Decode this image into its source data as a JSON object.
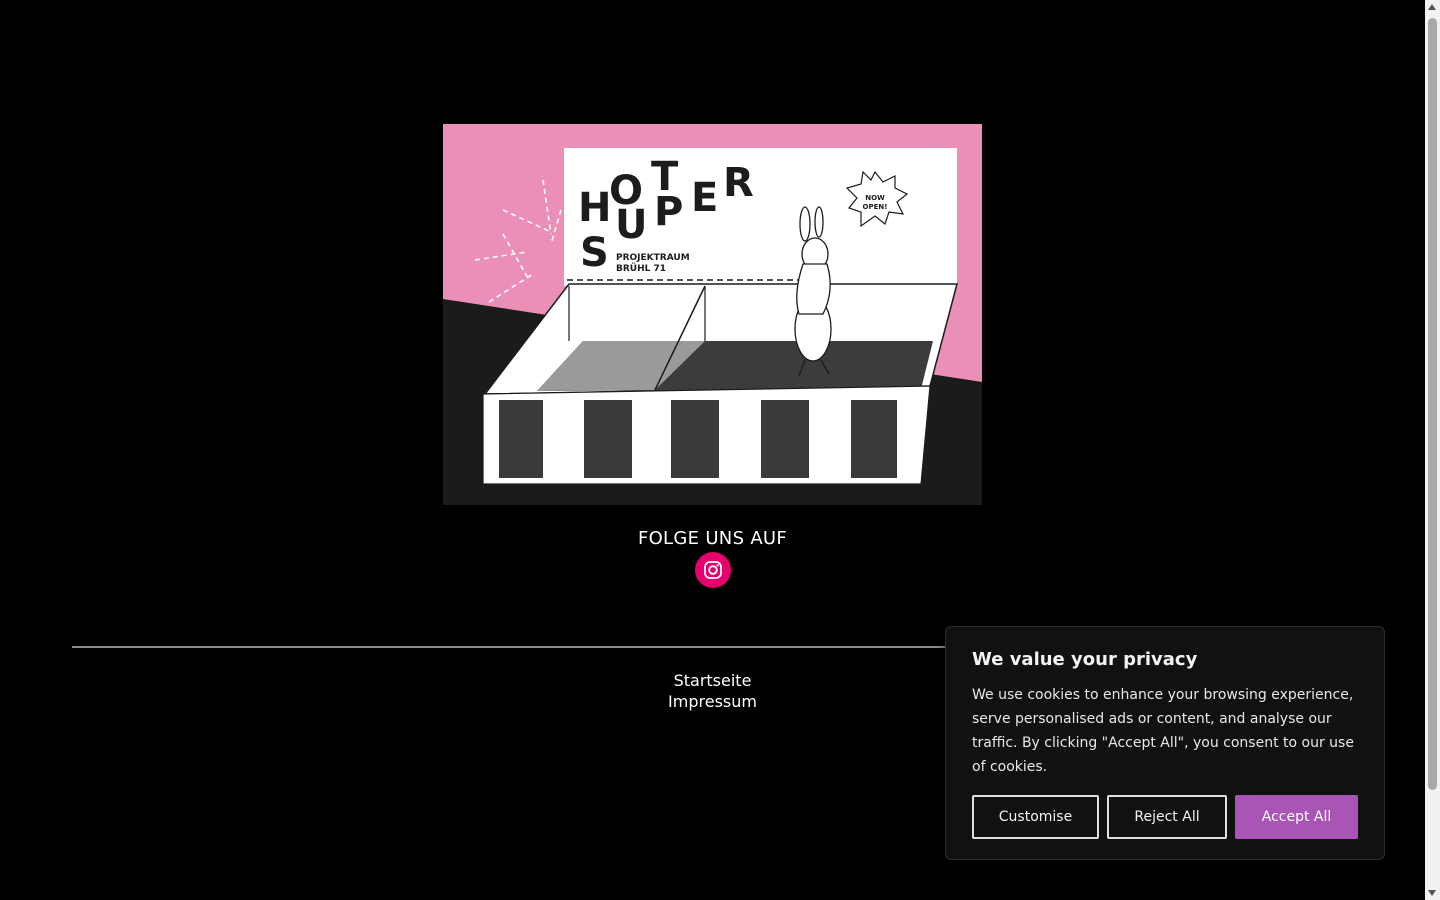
{
  "hero": {
    "alt": "Hot Super Projektraum Brühl 71 illustration",
    "logo_letters": [
      "H",
      "O",
      "T",
      "S",
      "U",
      "P",
      "E",
      "R",
      "S"
    ],
    "logo_subline_1": "PROJEKTRAUM",
    "logo_subline_2": "BRÜHL 71",
    "bubble_line_1": "NOW",
    "bubble_line_2": "OPEN!",
    "colors": {
      "pink": "#ea8fb5",
      "dark": "#1b1b1b",
      "paper": "#ffffff"
    }
  },
  "social": {
    "heading": "FOLGE UNS AUF",
    "instagram_icon": "instagram-icon",
    "instagram_color": "#e6006e"
  },
  "footer": {
    "links": [
      "Startseite",
      "Impressum"
    ]
  },
  "consent": {
    "title": "We value your privacy",
    "body": "We use cookies to enhance your browsing experience, serve personalised ads or content, and analyse our traffic. By clicking \"Accept All\", you consent to our use of cookies.",
    "customise_label": "Customise",
    "reject_label": "Reject All",
    "accept_label": "Accept All",
    "accent_color": "#a855b5"
  }
}
